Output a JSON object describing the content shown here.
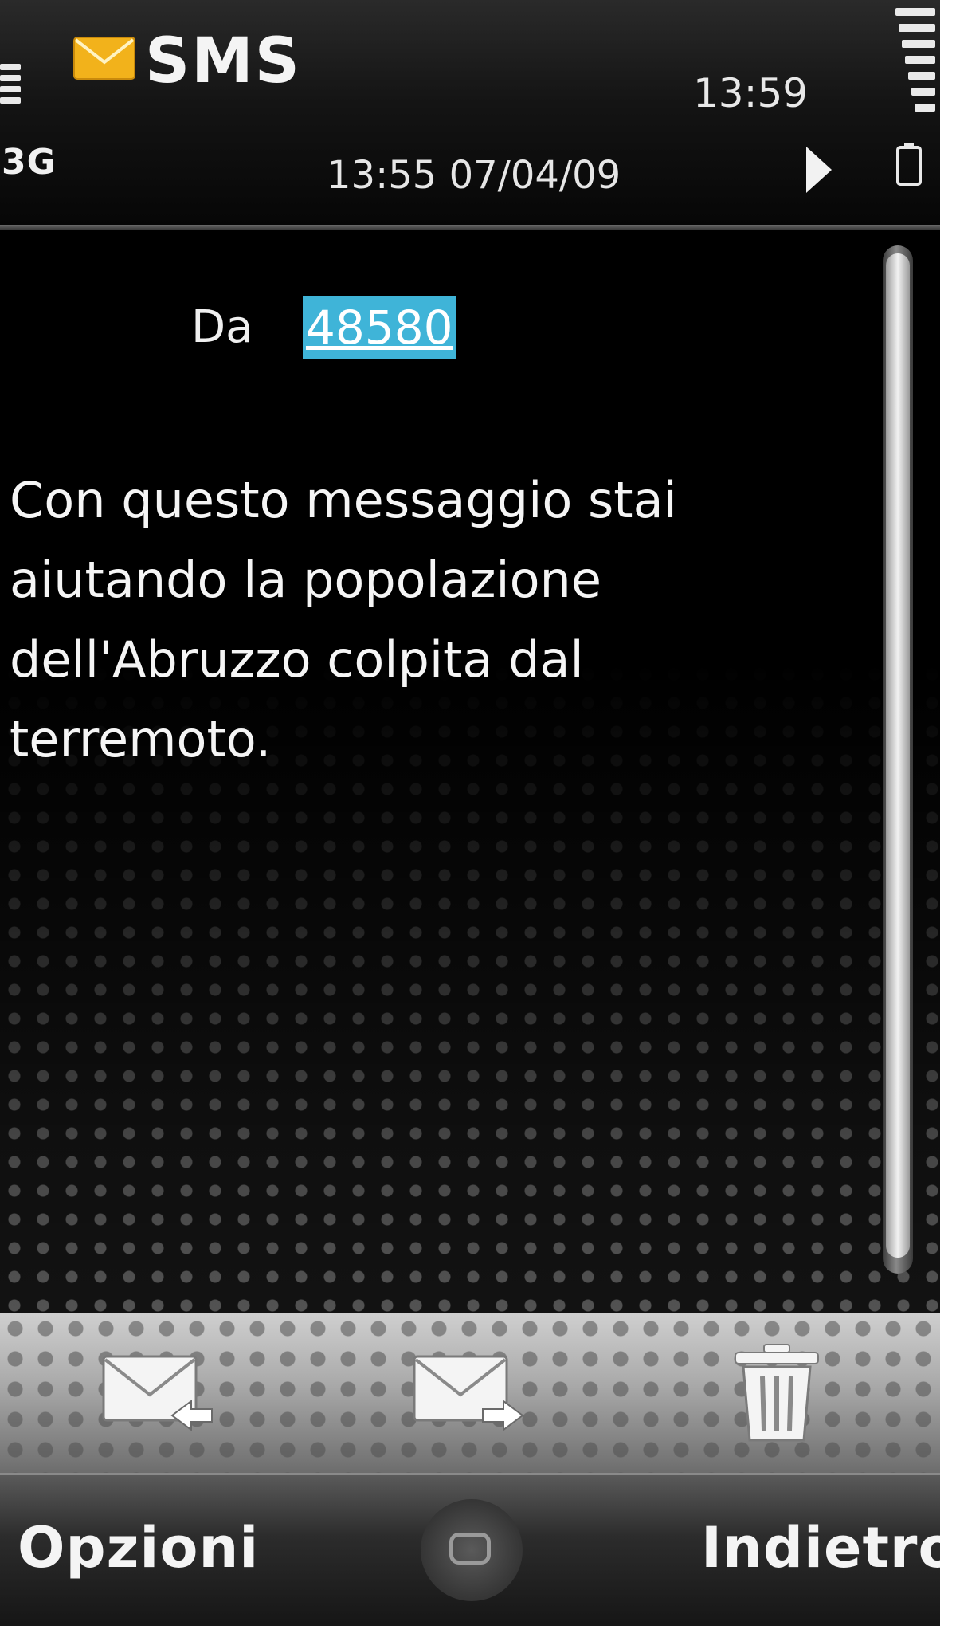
{
  "status_bar": {
    "network": "3G",
    "time": "13:59",
    "icons": {
      "signal": "signal-strength-icon",
      "battery": "battery-level-icon",
      "app": "envelope-icon",
      "play": "play-icon",
      "battery_small": "battery-icon"
    },
    "accent_color": "#f2b21b"
  },
  "header": {
    "title": "SMS",
    "timestamp": "13:55 07/04/09"
  },
  "message": {
    "from_label": "Da",
    "sender": "48580",
    "sender_highlight_color": "#3fb4d8",
    "body": "Con questo messaggio stai aiutando la popolazione dell'Abruzzo colpita dal terremoto."
  },
  "toolbar": {
    "reply_icon": "reply-envelope-icon",
    "forward_icon": "forward-envelope-icon",
    "delete_icon": "trash-icon"
  },
  "softkeys": {
    "left": "Opzioni",
    "right": "Indietro",
    "center_icon": "menu-key-icon"
  }
}
